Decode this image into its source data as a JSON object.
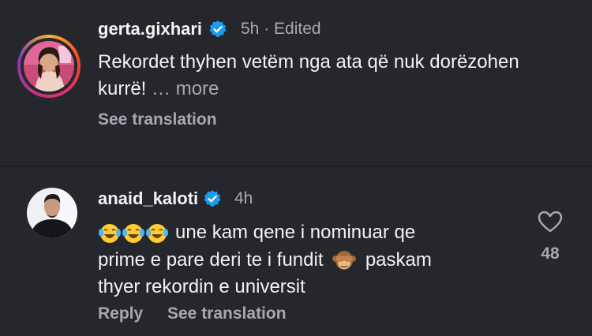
{
  "comments": [
    {
      "username": "gerta.gixhari",
      "verified": true,
      "time": "5h",
      "separator": "·",
      "edited": "Edited",
      "text_line1": "Rekordet thyhen vetëm nga ata që nuk dorëzohen",
      "text_line2": "kurrë!",
      "more": "… more",
      "see_translation": "See translation"
    },
    {
      "username": "anaid_kaloti",
      "verified": true,
      "time": "4h",
      "text_line1": "une kam qene i nominuar qe",
      "text_line2": "prime e pare deri te i fundit",
      "text_line2b": "paskam",
      "text_line3": "thyer rekordin e universit",
      "reply": "Reply",
      "see_translation": "See translation",
      "like_count": "48"
    }
  ],
  "icons": {
    "verified": "verified-badge-icon",
    "like": "heart-outline-icon",
    "laughing_emoji": "face-with-tears-of-joy-emoji",
    "monkey_emoji": "see-no-evil-monkey-emoji"
  },
  "colors": {
    "background": "#26272d",
    "verified_blue": "#1d9bf0",
    "muted": "#a8a9b0",
    "text": "#f2f2f4"
  }
}
